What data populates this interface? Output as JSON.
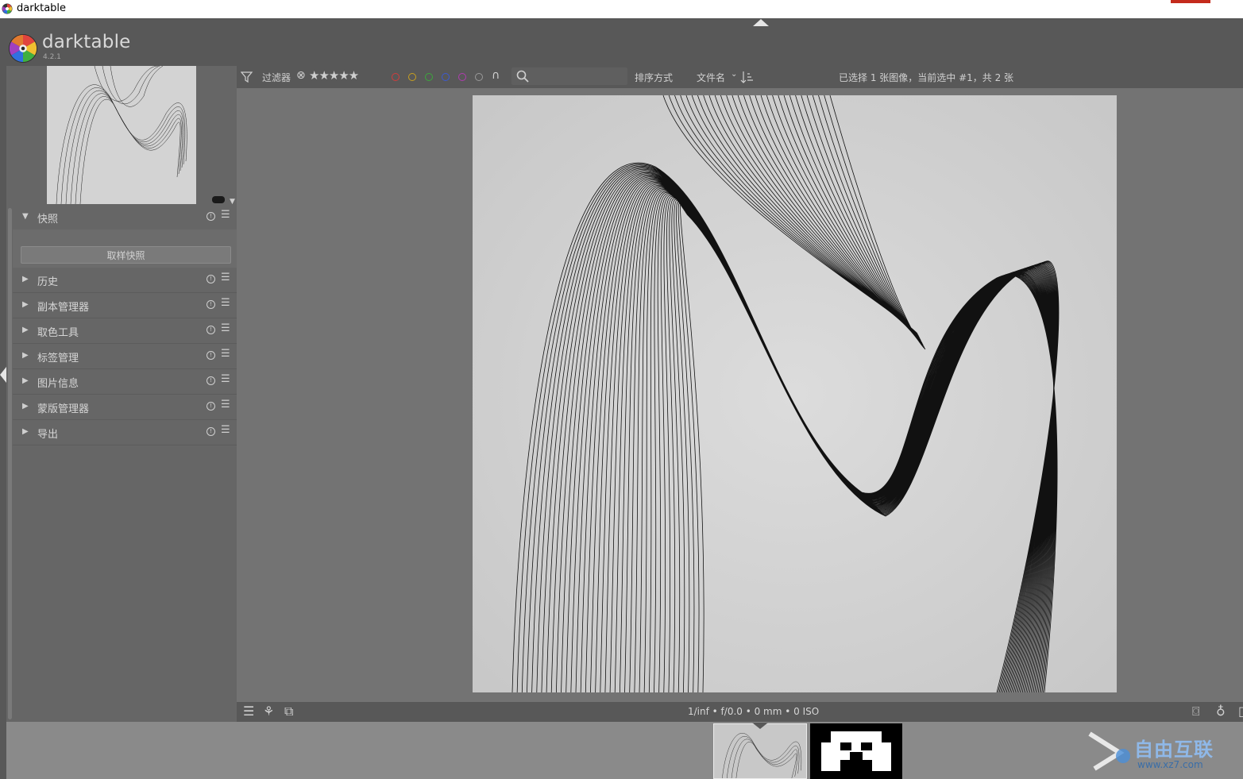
{
  "window": {
    "title": "darktable"
  },
  "header": {
    "brand": "darktable",
    "version": "4.2.1"
  },
  "modules": {
    "snapshots": {
      "label": "快照",
      "button": "取样快照"
    },
    "list": [
      {
        "label": "历史"
      },
      {
        "label": "副本管理器"
      },
      {
        "label": "取色工具"
      },
      {
        "label": "标签管理"
      },
      {
        "label": "图片信息"
      },
      {
        "label": "蒙版管理器"
      },
      {
        "label": "导出"
      }
    ]
  },
  "filterbar": {
    "filter_label": "过滤器",
    "stars": "★★★★★",
    "sort_label": "排序方式",
    "sort_value": "文件名",
    "search_placeholder": "",
    "status": "已选择 1 张图像，当前选中 #1，共 2 张",
    "color_labels": [
      "#d23c3c",
      "#c9a020",
      "#3ca83c",
      "#3c5ad2",
      "#b03cb0",
      "#9a9a9a"
    ]
  },
  "footer": {
    "exif": "1/inf • f/0.0 • 0 mm • 0 ISO"
  },
  "icons": {
    "filter": "filter-icon",
    "search": "search-icon",
    "sort": "sort-order-icon",
    "reset": "reset-icon",
    "presets": "presets-icon"
  },
  "watermark": {
    "text": "自由互联",
    "url": "www.xz7.com"
  }
}
